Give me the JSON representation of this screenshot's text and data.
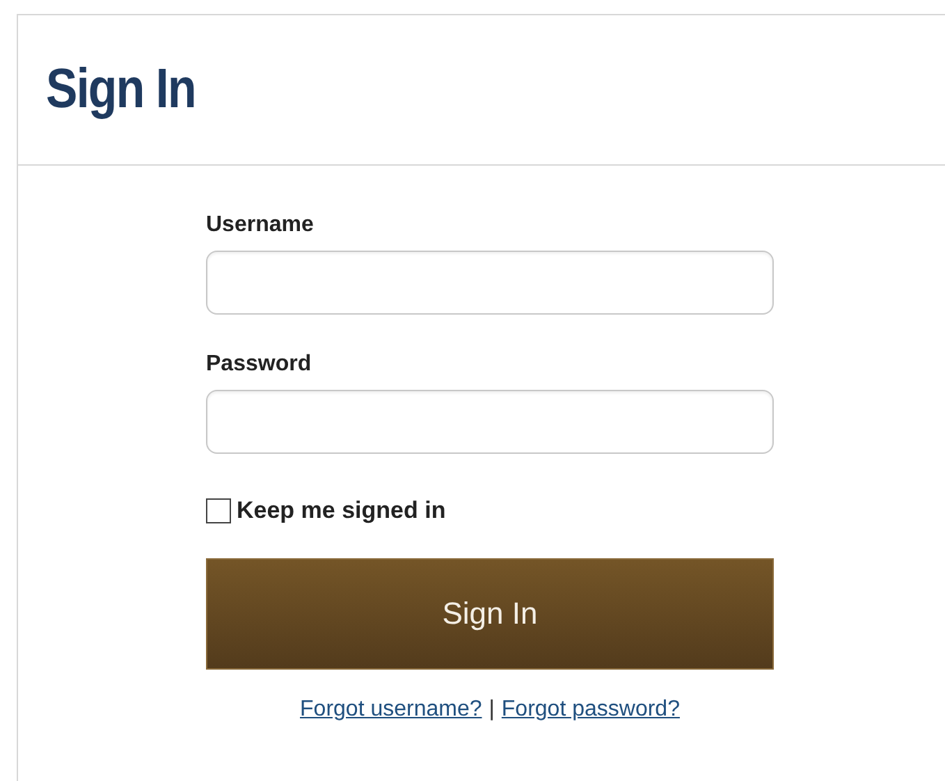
{
  "title": "Sign In",
  "fields": [
    {
      "label": "Username"
    },
    {
      "label": "Password"
    }
  ],
  "remember": {
    "label": "Keep me signed in",
    "checked": false
  },
  "submit": "Sign In",
  "links": [
    {
      "text": "Forgot username?"
    },
    {
      "text": "Forgot password?"
    }
  ],
  "link_separator": "|"
}
